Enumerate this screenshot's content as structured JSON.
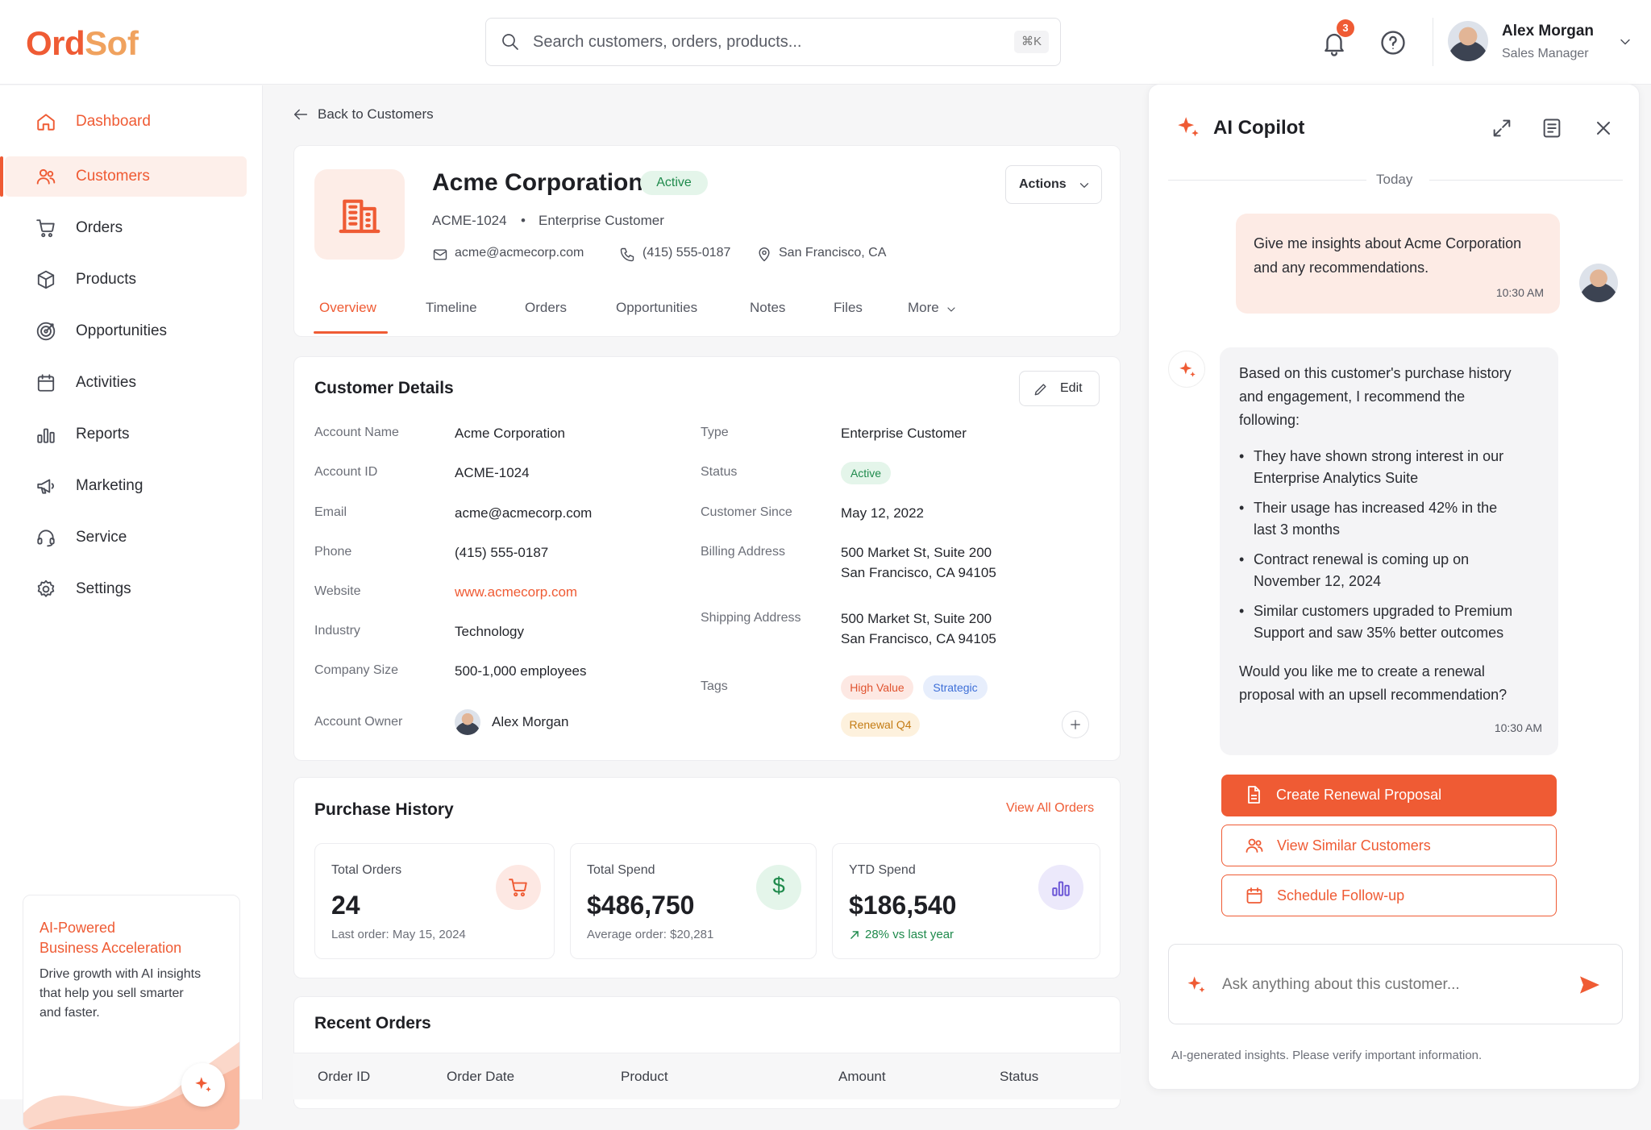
{
  "app": {
    "logo_part1": "Ord",
    "logo_part2": "Sof"
  },
  "search": {
    "placeholder": "Search customers, orders, products...",
    "shortcut": "⌘K"
  },
  "header": {
    "notification_count": "3",
    "user_name": "Alex Morgan",
    "user_role": "Sales Manager"
  },
  "sidebar": {
    "items": [
      {
        "label": "Dashboard",
        "icon": "home-icon"
      },
      {
        "label": "Customers",
        "icon": "users-icon"
      },
      {
        "label": "Orders",
        "icon": "cart-icon"
      },
      {
        "label": "Products",
        "icon": "box-icon"
      },
      {
        "label": "Opportunities",
        "icon": "target-icon"
      },
      {
        "label": "Activities",
        "icon": "calendar-icon"
      },
      {
        "label": "Reports",
        "icon": "bar-chart-icon"
      },
      {
        "label": "Marketing",
        "icon": "megaphone-icon"
      },
      {
        "label": "Service",
        "icon": "headset-icon"
      },
      {
        "label": "Settings",
        "icon": "gear-icon"
      }
    ],
    "promo": {
      "title_line1": "AI-Powered",
      "title_line2": "Business Acceleration",
      "body_line1": "Drive growth with AI insights",
      "body_line2": "that help you sell smarter",
      "body_line3": "and faster."
    }
  },
  "breadcrumb": {
    "back": "Back to Customers"
  },
  "customer": {
    "name": "Acme Corporation",
    "status": "Active",
    "id": "ACME-1024",
    "separator": "•",
    "type": "Enterprise Customer",
    "email": "acme@acmecorp.com",
    "phone": "(415) 555-0187",
    "location": "San Francisco, CA",
    "actions_label": "Actions"
  },
  "tabs": [
    {
      "label": "Overview",
      "active": true
    },
    {
      "label": "Timeline"
    },
    {
      "label": "Orders"
    },
    {
      "label": "Opportunities"
    },
    {
      "label": "Notes"
    },
    {
      "label": "Files"
    },
    {
      "label": "More"
    }
  ],
  "details": {
    "title": "Customer Details",
    "edit_label": "Edit",
    "left": [
      {
        "label": "Account Name",
        "value": "Acme Corporation"
      },
      {
        "label": "Account ID",
        "value": "ACME-1024"
      },
      {
        "label": "Email",
        "value": "acme@acmecorp.com"
      },
      {
        "label": "Phone",
        "value": "(415) 555-0187"
      },
      {
        "label": "Website",
        "value": "www.acmecorp.com"
      },
      {
        "label": "Industry",
        "value": "Technology"
      },
      {
        "label": "Company Size",
        "value": "500-1,000 employees"
      },
      {
        "label": "Account Owner",
        "value": "Alex Morgan"
      }
    ],
    "right": {
      "type_label": "Type",
      "type_value": "Enterprise Customer",
      "status_label": "Status",
      "status_value": "Active",
      "since_label": "Customer Since",
      "since_value": "May 12, 2022",
      "billing_label": "Billing Address",
      "billing_line1": "500 Market St, Suite 200",
      "billing_line2": "San Francisco, CA 94105",
      "shipping_label": "Shipping Address",
      "shipping_line1": "500 Market St, Suite 200",
      "shipping_line2": "San Francisco, CA 94105",
      "tags_label": "Tags",
      "tags": [
        "High Value",
        "Strategic",
        "Renewal Q4"
      ]
    }
  },
  "purchase": {
    "title": "Purchase History",
    "view_all": "View All Orders",
    "stats": [
      {
        "title": "Total Orders",
        "value": "24",
        "sub": "Last order: May 15, 2024",
        "icon": "cart-icon"
      },
      {
        "title": "Total Spend",
        "value": "$486,750",
        "sub": "Average order: $20,281",
        "icon": "dollar-icon"
      },
      {
        "title": "YTD Spend",
        "value": "$186,540",
        "sub": "28% vs last year",
        "icon": "bar-chart-icon"
      }
    ]
  },
  "recent_orders": {
    "title": "Recent Orders",
    "columns": [
      "Order ID",
      "Order Date",
      "Product",
      "Amount",
      "Status"
    ]
  },
  "copilot": {
    "title": "AI Copilot",
    "date_divider": "Today",
    "user_message_line1": "Give me insights about Acme Corporation",
    "user_message_line2": "and any recommendations.",
    "user_time": "10:30 AM",
    "ai_intro_line1": "Based on this customer's purchase history",
    "ai_intro_line2": "and engagement, I recommend the",
    "ai_intro_line3": "following:",
    "ai_bullets": [
      {
        "line1": "They have shown strong interest in our",
        "line2": "Enterprise Analytics Suite"
      },
      {
        "line1": "Their usage has increased 42% in the",
        "line2": "last 3 months"
      },
      {
        "line1": "Contract renewal is coming up on",
        "line2": "November 12, 2024"
      },
      {
        "line1": "Similar customers upgraded to Premium",
        "line2": "Support and saw 35% better outcomes"
      }
    ],
    "ai_question_line1": "Would you like me to create a renewal",
    "ai_question_line2": "proposal with an upsell recommendation?",
    "ai_time": "10:30 AM",
    "actions": [
      "Create Renewal Proposal",
      "View Similar Customers",
      "Schedule Follow-up"
    ],
    "input_placeholder": "Ask anything about this customer...",
    "disclaimer": "AI-generated insights. Please verify important information."
  },
  "colors": {
    "accent": "#ef5b34",
    "active_green": "#1f8a4c",
    "strategic_blue": "#3d6fd8"
  }
}
